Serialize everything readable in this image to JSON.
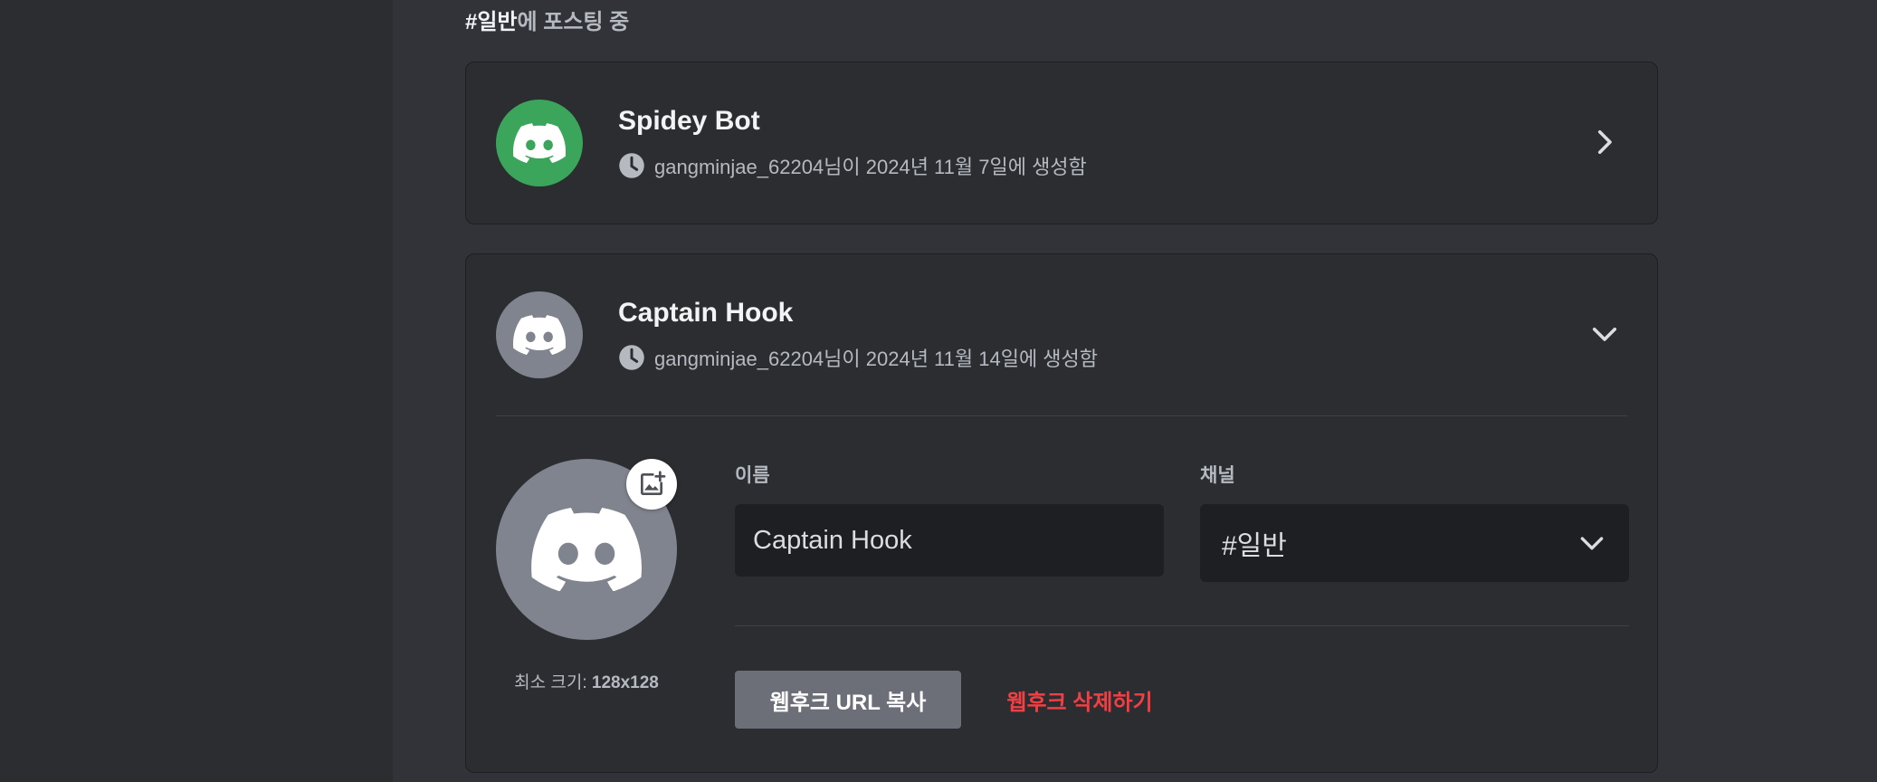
{
  "posting": {
    "channel": "#일반",
    "suffix": "에 포스팅 중"
  },
  "webhooks": [
    {
      "name": "Spidey Bot",
      "meta": "gangminjae_62204님이 2024년 11월 7일에 생성함",
      "avatar_color": "#3ba55c"
    },
    {
      "name": "Captain Hook",
      "meta": "gangminjae_62204님이 2024년 11월 14일에 생성함",
      "avatar_color": "#80848e"
    }
  ],
  "editor": {
    "min_size_label": "최소 크기: ",
    "min_size_value": "128x128",
    "name_label": "이름",
    "name_value": "Captain Hook",
    "channel_label": "채널",
    "channel_value": "#일반",
    "copy_url_label": "웹후크 URL 복사",
    "delete_label": "웹후크 삭제하기"
  },
  "icons": {
    "avatar": "discord-logo-icon",
    "clock": "clock-icon",
    "upload": "image-add-icon",
    "expand": "chevron-right-icon",
    "collapse": "chevron-down-icon",
    "dropdown": "chevron-down-icon"
  },
  "colors": {
    "background": "#313338",
    "sidebar": "#2b2d31",
    "card": "#2b2d31",
    "input": "#1e1f22",
    "danger": "#f23f43",
    "secondary_button": "#6d6f78"
  }
}
